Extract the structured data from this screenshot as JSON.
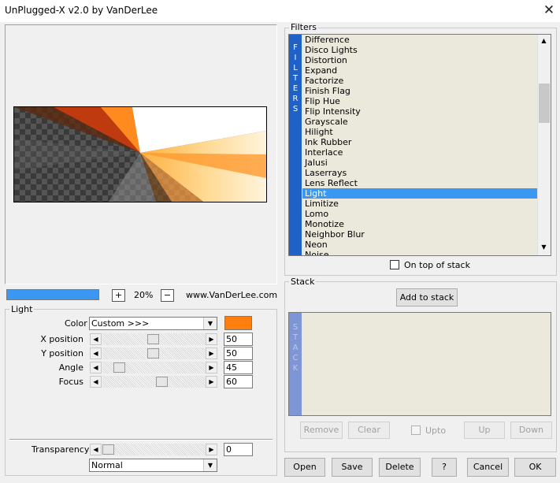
{
  "window": {
    "title": "UnPlugged-X v2.0 by VanDerLee",
    "close_glyph": "✕"
  },
  "preview": {
    "zoom_value": "20%",
    "zoom_in": "+",
    "zoom_out": "−",
    "website": "www.VanDerLee.com"
  },
  "light": {
    "group_label": "Light",
    "color_label": "Color",
    "color_value": "Custom >>>",
    "color_swatch": "#ff7f0e",
    "params": [
      {
        "label": "X position",
        "value": "50",
        "fraction": 0.5
      },
      {
        "label": "Y position",
        "value": "50",
        "fraction": 0.5
      },
      {
        "label": "Angle",
        "value": "45",
        "fraction": 0.125
      },
      {
        "label": "Focus",
        "value": "60",
        "fraction": 0.6
      }
    ],
    "transparency_label": "Transparency",
    "transparency_value": "0",
    "transparency_fraction": 0.0,
    "blend_mode": "Normal"
  },
  "filters": {
    "group_label": "Filters",
    "tab_letters": [
      "F",
      "I",
      "L",
      "T",
      "E",
      "R",
      "S"
    ],
    "items": [
      "Difference",
      "Disco Lights",
      "Distortion",
      "Expand",
      "Factorize",
      "Finish Flag",
      "Flip Hue",
      "Flip Intensity",
      "Grayscale",
      "Hilight",
      "Ink Rubber",
      "Interlace",
      "Jalusi",
      "Laserrays",
      "Lens Reflect",
      "Light",
      "Limitize",
      "Lomo",
      "Monotize",
      "Neighbor Blur",
      "Neon",
      "Noise"
    ],
    "selected": "Light",
    "on_top_label": "On top of stack"
  },
  "stack": {
    "group_label": "Stack",
    "tab_letters": [
      "S",
      "T",
      "A",
      "C",
      "K"
    ],
    "add_label": "Add to stack",
    "remove_label": "Remove",
    "clear_label": "Clear",
    "upto_label": "Upto",
    "up_label": "Up",
    "down_label": "Down"
  },
  "footer": {
    "open": "Open",
    "save": "Save",
    "delete": "Delete",
    "help": "?",
    "cancel": "Cancel",
    "ok": "OK"
  },
  "colors": {
    "progress": "#3a98f3",
    "selection": "#3a98f3",
    "tab": "#1e62c8"
  }
}
